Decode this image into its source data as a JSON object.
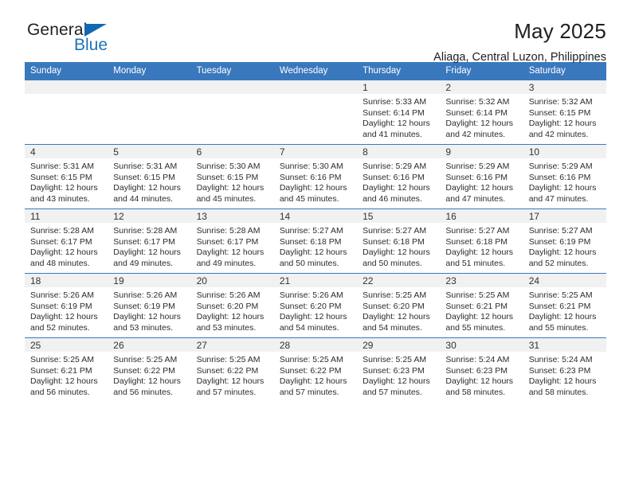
{
  "brand": {
    "name_part1": "General",
    "name_part2": "Blue"
  },
  "header": {
    "title": "May 2025",
    "subtitle": "Aliaga, Central Luzon, Philippines"
  },
  "colors": {
    "header_blue": "#3a78bd",
    "logo_blue": "#1b75bb",
    "daynum_band": "#f1f1f1"
  },
  "weekdays": [
    "Sunday",
    "Monday",
    "Tuesday",
    "Wednesday",
    "Thursday",
    "Friday",
    "Saturday"
  ],
  "labels": {
    "sunrise": "Sunrise:",
    "sunset": "Sunset:",
    "daylight": "Daylight:"
  },
  "weeks": [
    [
      {
        "day": "",
        "empty": true
      },
      {
        "day": "",
        "empty": true
      },
      {
        "day": "",
        "empty": true
      },
      {
        "day": "",
        "empty": true
      },
      {
        "day": "1",
        "sunrise": "Sunrise: 5:33 AM",
        "sunset": "Sunset: 6:14 PM",
        "daylight": "Daylight: 12 hours and 41 minutes."
      },
      {
        "day": "2",
        "sunrise": "Sunrise: 5:32 AM",
        "sunset": "Sunset: 6:14 PM",
        "daylight": "Daylight: 12 hours and 42 minutes."
      },
      {
        "day": "3",
        "sunrise": "Sunrise: 5:32 AM",
        "sunset": "Sunset: 6:15 PM",
        "daylight": "Daylight: 12 hours and 42 minutes."
      }
    ],
    [
      {
        "day": "4",
        "sunrise": "Sunrise: 5:31 AM",
        "sunset": "Sunset: 6:15 PM",
        "daylight": "Daylight: 12 hours and 43 minutes."
      },
      {
        "day": "5",
        "sunrise": "Sunrise: 5:31 AM",
        "sunset": "Sunset: 6:15 PM",
        "daylight": "Daylight: 12 hours and 44 minutes."
      },
      {
        "day": "6",
        "sunrise": "Sunrise: 5:30 AM",
        "sunset": "Sunset: 6:15 PM",
        "daylight": "Daylight: 12 hours and 45 minutes."
      },
      {
        "day": "7",
        "sunrise": "Sunrise: 5:30 AM",
        "sunset": "Sunset: 6:16 PM",
        "daylight": "Daylight: 12 hours and 45 minutes."
      },
      {
        "day": "8",
        "sunrise": "Sunrise: 5:29 AM",
        "sunset": "Sunset: 6:16 PM",
        "daylight": "Daylight: 12 hours and 46 minutes."
      },
      {
        "day": "9",
        "sunrise": "Sunrise: 5:29 AM",
        "sunset": "Sunset: 6:16 PM",
        "daylight": "Daylight: 12 hours and 47 minutes."
      },
      {
        "day": "10",
        "sunrise": "Sunrise: 5:29 AM",
        "sunset": "Sunset: 6:16 PM",
        "daylight": "Daylight: 12 hours and 47 minutes."
      }
    ],
    [
      {
        "day": "11",
        "sunrise": "Sunrise: 5:28 AM",
        "sunset": "Sunset: 6:17 PM",
        "daylight": "Daylight: 12 hours and 48 minutes."
      },
      {
        "day": "12",
        "sunrise": "Sunrise: 5:28 AM",
        "sunset": "Sunset: 6:17 PM",
        "daylight": "Daylight: 12 hours and 49 minutes."
      },
      {
        "day": "13",
        "sunrise": "Sunrise: 5:28 AM",
        "sunset": "Sunset: 6:17 PM",
        "daylight": "Daylight: 12 hours and 49 minutes."
      },
      {
        "day": "14",
        "sunrise": "Sunrise: 5:27 AM",
        "sunset": "Sunset: 6:18 PM",
        "daylight": "Daylight: 12 hours and 50 minutes."
      },
      {
        "day": "15",
        "sunrise": "Sunrise: 5:27 AM",
        "sunset": "Sunset: 6:18 PM",
        "daylight": "Daylight: 12 hours and 50 minutes."
      },
      {
        "day": "16",
        "sunrise": "Sunrise: 5:27 AM",
        "sunset": "Sunset: 6:18 PM",
        "daylight": "Daylight: 12 hours and 51 minutes."
      },
      {
        "day": "17",
        "sunrise": "Sunrise: 5:27 AM",
        "sunset": "Sunset: 6:19 PM",
        "daylight": "Daylight: 12 hours and 52 minutes."
      }
    ],
    [
      {
        "day": "18",
        "sunrise": "Sunrise: 5:26 AM",
        "sunset": "Sunset: 6:19 PM",
        "daylight": "Daylight: 12 hours and 52 minutes."
      },
      {
        "day": "19",
        "sunrise": "Sunrise: 5:26 AM",
        "sunset": "Sunset: 6:19 PM",
        "daylight": "Daylight: 12 hours and 53 minutes."
      },
      {
        "day": "20",
        "sunrise": "Sunrise: 5:26 AM",
        "sunset": "Sunset: 6:20 PM",
        "daylight": "Daylight: 12 hours and 53 minutes."
      },
      {
        "day": "21",
        "sunrise": "Sunrise: 5:26 AM",
        "sunset": "Sunset: 6:20 PM",
        "daylight": "Daylight: 12 hours and 54 minutes."
      },
      {
        "day": "22",
        "sunrise": "Sunrise: 5:25 AM",
        "sunset": "Sunset: 6:20 PM",
        "daylight": "Daylight: 12 hours and 54 minutes."
      },
      {
        "day": "23",
        "sunrise": "Sunrise: 5:25 AM",
        "sunset": "Sunset: 6:21 PM",
        "daylight": "Daylight: 12 hours and 55 minutes."
      },
      {
        "day": "24",
        "sunrise": "Sunrise: 5:25 AM",
        "sunset": "Sunset: 6:21 PM",
        "daylight": "Daylight: 12 hours and 55 minutes."
      }
    ],
    [
      {
        "day": "25",
        "sunrise": "Sunrise: 5:25 AM",
        "sunset": "Sunset: 6:21 PM",
        "daylight": "Daylight: 12 hours and 56 minutes."
      },
      {
        "day": "26",
        "sunrise": "Sunrise: 5:25 AM",
        "sunset": "Sunset: 6:22 PM",
        "daylight": "Daylight: 12 hours and 56 minutes."
      },
      {
        "day": "27",
        "sunrise": "Sunrise: 5:25 AM",
        "sunset": "Sunset: 6:22 PM",
        "daylight": "Daylight: 12 hours and 57 minutes."
      },
      {
        "day": "28",
        "sunrise": "Sunrise: 5:25 AM",
        "sunset": "Sunset: 6:22 PM",
        "daylight": "Daylight: 12 hours and 57 minutes."
      },
      {
        "day": "29",
        "sunrise": "Sunrise: 5:25 AM",
        "sunset": "Sunset: 6:23 PM",
        "daylight": "Daylight: 12 hours and 57 minutes."
      },
      {
        "day": "30",
        "sunrise": "Sunrise: 5:24 AM",
        "sunset": "Sunset: 6:23 PM",
        "daylight": "Daylight: 12 hours and 58 minutes."
      },
      {
        "day": "31",
        "sunrise": "Sunrise: 5:24 AM",
        "sunset": "Sunset: 6:23 PM",
        "daylight": "Daylight: 12 hours and 58 minutes."
      }
    ]
  ]
}
